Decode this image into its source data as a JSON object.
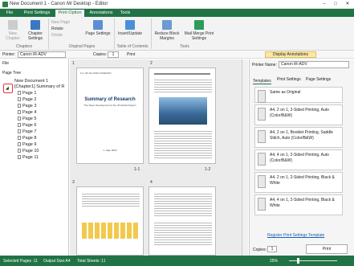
{
  "window": {
    "title": "New Document 1 - Canon iW Desktop - Editor"
  },
  "tabs": [
    {
      "label": "File",
      "active": false
    },
    {
      "label": "Print Settings",
      "active": false
    },
    {
      "label": "Print Option",
      "active": true
    },
    {
      "label": "Annotations",
      "active": false
    },
    {
      "label": "Tools",
      "active": false
    }
  ],
  "ribbon": {
    "new_chapter": "New Chapter",
    "chapter_settings": "Chapter Settings",
    "new_page": "New Page",
    "rotate": "Rotate",
    "divide": "Divide",
    "page_settings": "Page Settings",
    "insert_update": "Insert/Update",
    "reduce_block": "Reduce Block Margins",
    "mail_merge": "Mail Merge Print Settings",
    "groups": {
      "chapters": "Chapters",
      "original_pages": "Original Pages",
      "toc": "Table of Contents",
      "tools": "Tools"
    }
  },
  "toolbar": {
    "printer_label": "Printer:",
    "printer_value": "Canon iR-ADV",
    "copies_label": "Copies:",
    "copies_value": "1",
    "print_label": "Print",
    "display_annotations": "Display Annotations"
  },
  "left": {
    "file_label": "File",
    "page_tree_label": "Page Tree",
    "doc_name": "New Document 1",
    "chapter": "[Chapter1] Summary of R",
    "pages": [
      "Page 1",
      "Page 2",
      "Page 3",
      "Page 4",
      "Page 5",
      "Page 6",
      "Page 7",
      "Page 8",
      "Page 9",
      "Page 10",
      "Page 11"
    ]
  },
  "center": {
    "page_labels": [
      "1",
      "2",
      "3",
      "4"
    ],
    "spread_labels": [
      "1-1",
      "1-2"
    ],
    "doc_title": "Summary of Research",
    "doc_subtitle": "The Tokyo Development of the JP Global System",
    "doc_date": "1. Sept 2023",
    "doc_corner": "For 'IW' Rel 0020 SUMMARY"
  },
  "right": {
    "printer_name_label": "Printer Name:",
    "printer_name_value": "Canon iR-ADV",
    "tabs": [
      "Templates",
      "Print Settings",
      "Page Settings"
    ],
    "templates": [
      "Same as Original",
      "A4, 2 on 1, 2-Sided Printing, Auto (Color/B&W)",
      "A4, 2 on 1, Booklet Printing, Saddle Stitch, Auto (Color/B&W)",
      "A4, 4 on 1, 2-Sided Printing, Auto (Color/B&W)",
      "A4, 2 on 1, 2-Sided Printing, Black & White",
      "A4, 4 on 1, 2-Sided Printing, Black & White"
    ],
    "register_link": "Register Print Settings Template",
    "copies_label": "Copies:",
    "copies_value": "1",
    "print_button": "Print"
  },
  "status": {
    "selected": "Selected Pages :11",
    "output": "Output Size:A4",
    "total": "Total Sheets :11",
    "zoom": "25%"
  },
  "colors": {
    "accent": "#217346",
    "highlight": "#e53935"
  }
}
